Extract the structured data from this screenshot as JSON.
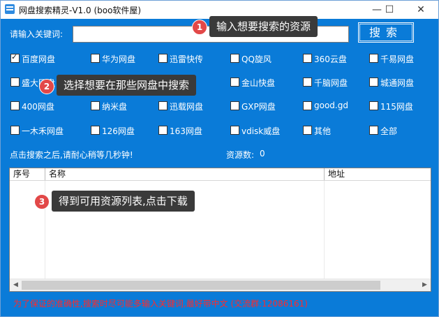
{
  "window": {
    "title": "网盘搜索精灵-V1.0 (boo软件屋)",
    "minimize_glyph": "—",
    "maximize_glyph": "☐",
    "close_glyph": "✕"
  },
  "search": {
    "label": "请输入关键词:",
    "value": "",
    "button_label": "搜索"
  },
  "checkboxes": [
    {
      "label": "百度网盘",
      "checked": true
    },
    {
      "label": "华为网盘",
      "checked": false
    },
    {
      "label": "迅雷快传",
      "checked": false
    },
    {
      "label": "QQ旋风",
      "checked": false
    },
    {
      "label": "360云盘",
      "checked": false
    },
    {
      "label": "千易网盘",
      "checked": false
    },
    {
      "label": "盛大网盘",
      "checked": false
    },
    {
      "label": "",
      "checked": false
    },
    {
      "label": "",
      "checked": false
    },
    {
      "label": "金山快盘",
      "checked": false
    },
    {
      "label": "千脑网盘",
      "checked": false
    },
    {
      "label": "城通网盘",
      "checked": false
    },
    {
      "label": "400网盘",
      "checked": false
    },
    {
      "label": "纳米盘",
      "checked": false
    },
    {
      "label": "迅载网盘",
      "checked": false
    },
    {
      "label": "GXP网盘",
      "checked": false
    },
    {
      "label": "good.gd",
      "checked": false
    },
    {
      "label": "115网盘",
      "checked": false
    },
    {
      "label": "一木禾网盘",
      "checked": false
    },
    {
      "label": "126网盘",
      "checked": false
    },
    {
      "label": "163网盘",
      "checked": false
    },
    {
      "label": "vdisk威盘",
      "checked": false
    },
    {
      "label": "其他",
      "checked": false
    },
    {
      "label": "全部",
      "checked": false
    }
  ],
  "status": {
    "hint": "点击搜索之后,请耐心稍等几秒钟!",
    "count_label": "资源数:",
    "count_value": "0"
  },
  "table": {
    "columns": [
      "序号",
      "名称",
      "地址"
    ]
  },
  "footer_note": "为了保证的准确性,搜索时尽可能多输入关键词,最好带中文 (交流群:12086161)",
  "callouts": [
    {
      "number": "1",
      "text": "输入想要搜索的资源"
    },
    {
      "number": "2",
      "text": "选择想要在那些网盘中搜索"
    },
    {
      "number": "3",
      "text": "得到可用资源列表,点击下载"
    }
  ],
  "colors": {
    "background": "#0a7bd8",
    "note_red": "#ff2a2a",
    "callout_bg": "#3a3a3a",
    "badge_red": "#e24848"
  },
  "icons": {
    "app": "app-icon",
    "scroll_left": "scroll-left-arrow-icon",
    "scroll_right": "scroll-right-arrow-icon"
  }
}
